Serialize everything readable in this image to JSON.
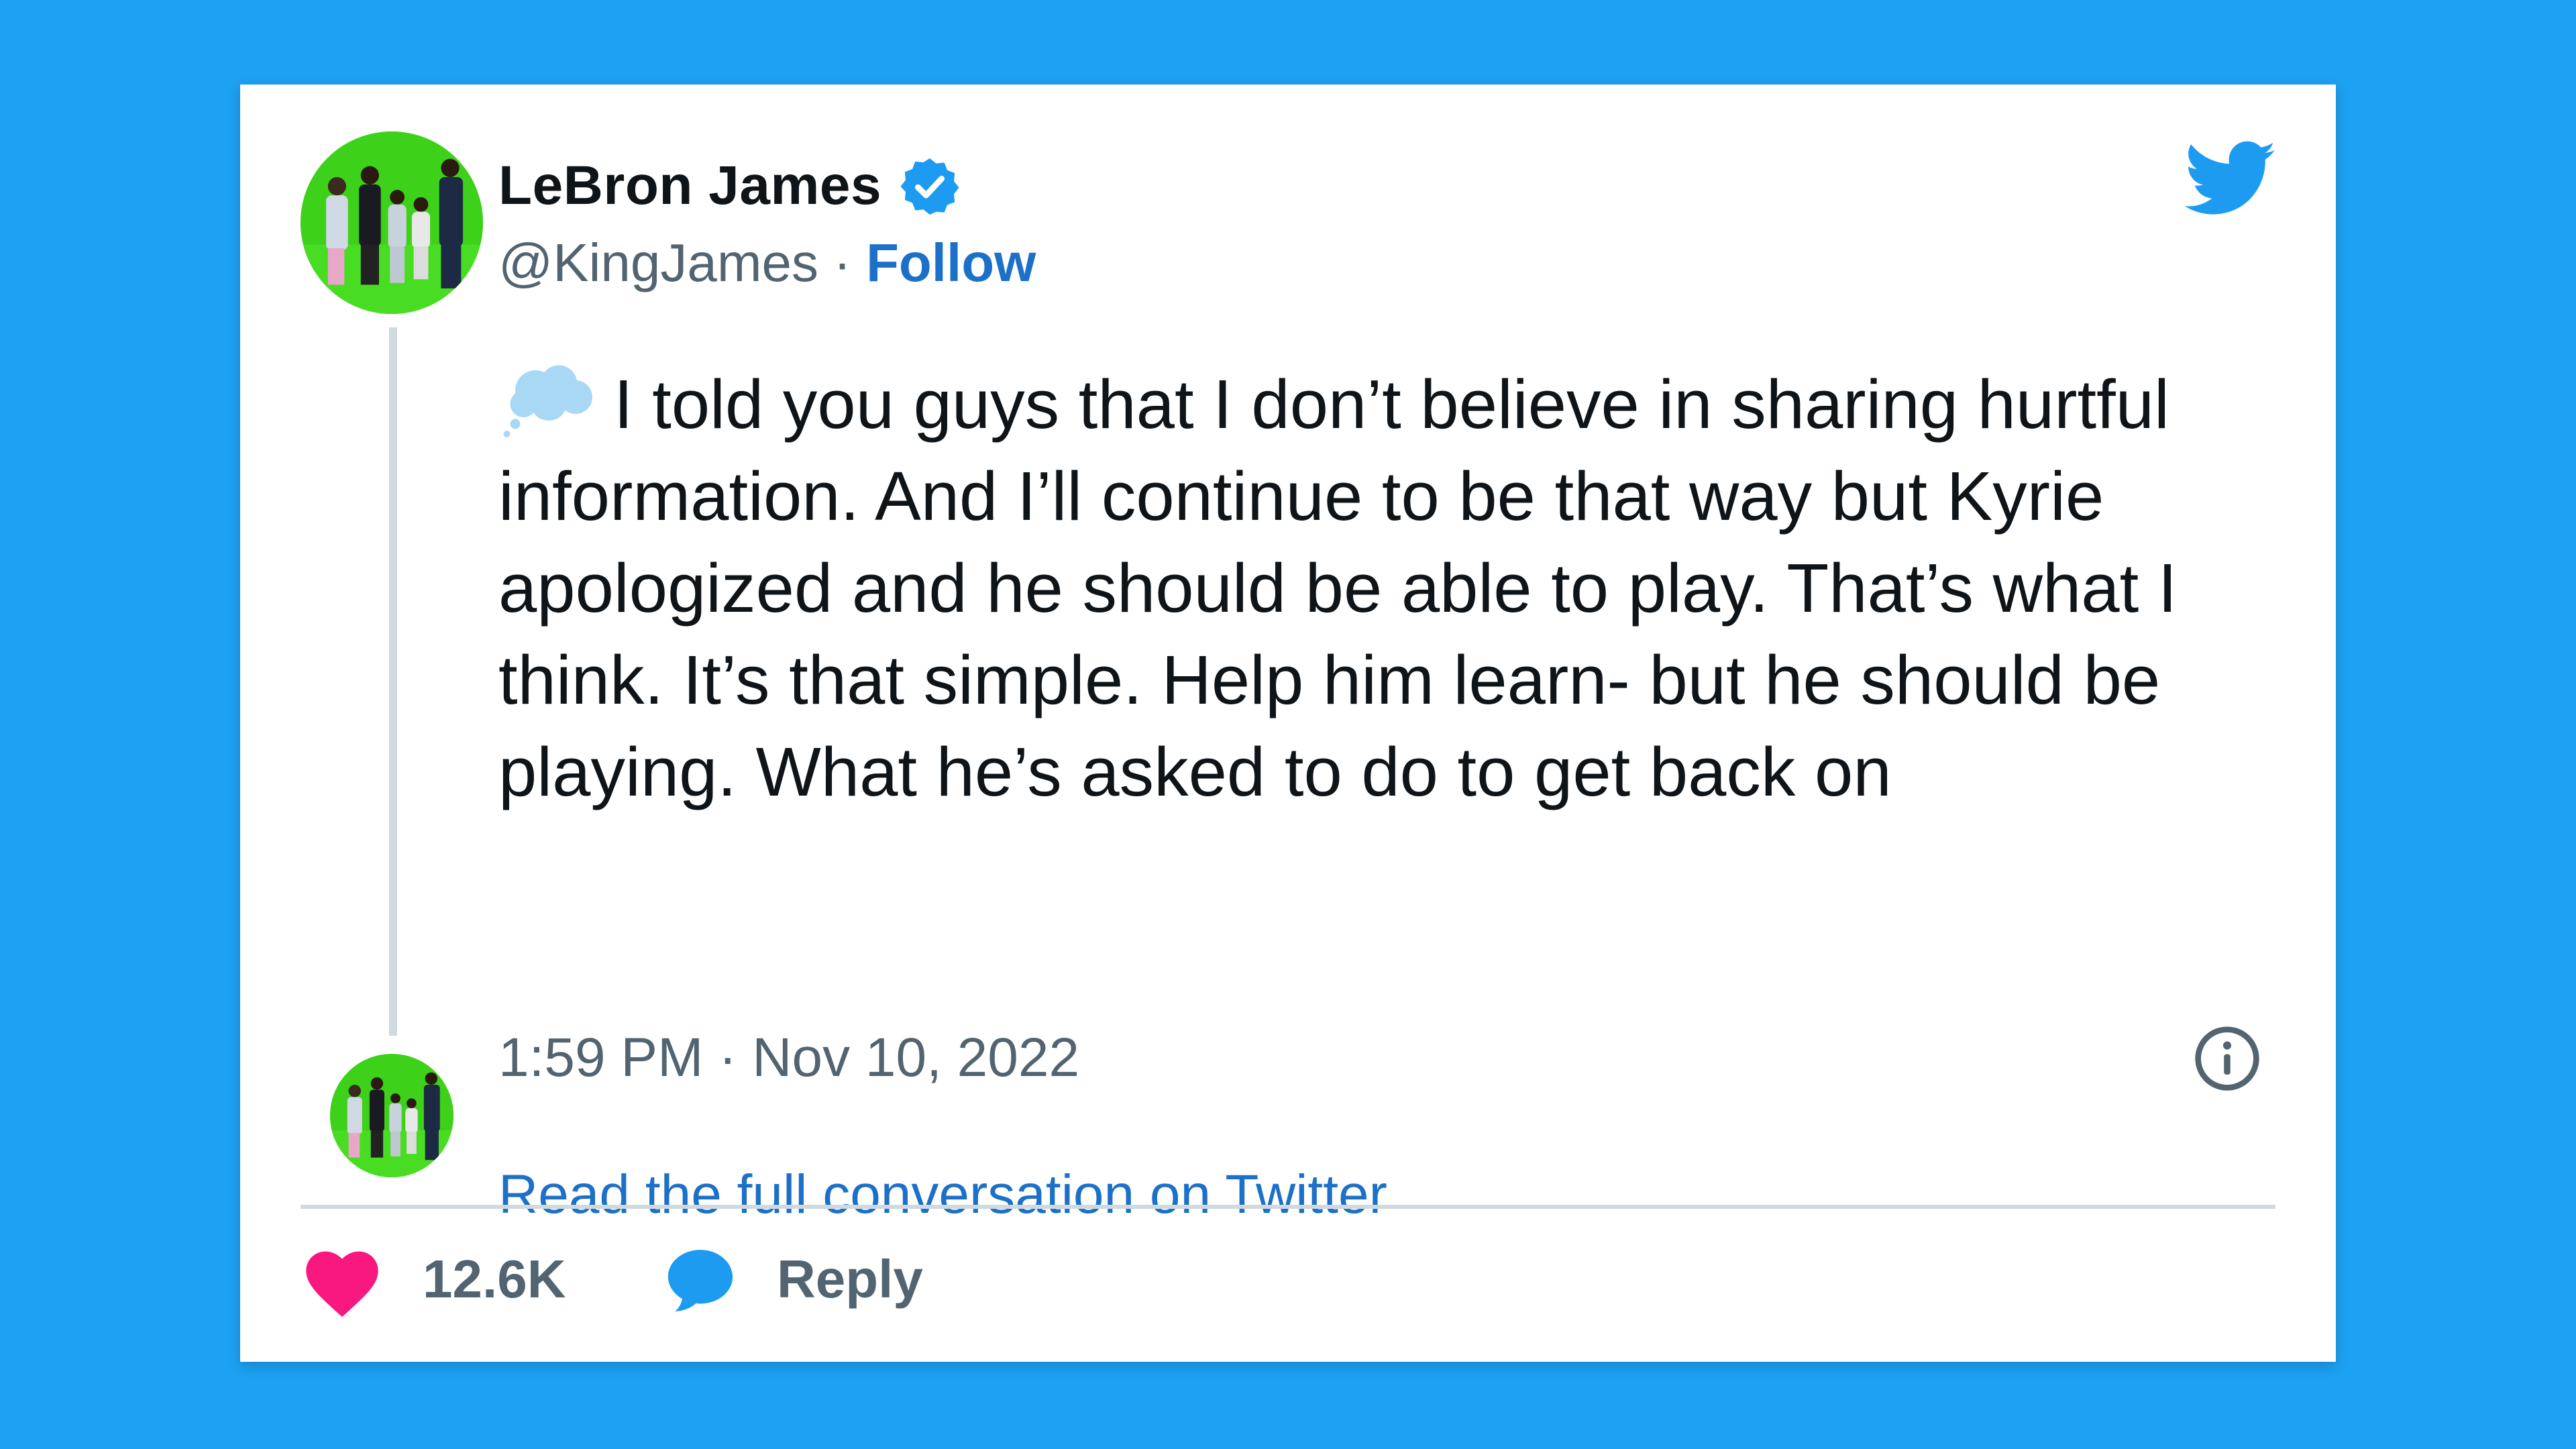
{
  "user": {
    "name": "LeBron James",
    "handle": "@KingJames",
    "separator": "·",
    "follow_label": "Follow"
  },
  "tweet": {
    "text": "I told you guys that I don’t believe in sharing hurtful information. And I’ll continue to be that way but Kyrie apologized and he should be able to play. That’s what I think. It’s that simple.  Help him learn- but he should be playing. What he’s asked to do to get back on",
    "emoji": "thought-balloon-icon",
    "timestamp": "1:59 PM · Nov 10, 2022"
  },
  "footer": {
    "read_full_label": "Read the full conversation on Twitter",
    "like_count": "12.6K",
    "reply_label": "Reply"
  },
  "colors": {
    "page_background": "#1da1f2",
    "card_background": "#ffffff",
    "link_blue": "#1d70c8",
    "heart_pink": "#f91880",
    "text_gray": "#536471"
  }
}
